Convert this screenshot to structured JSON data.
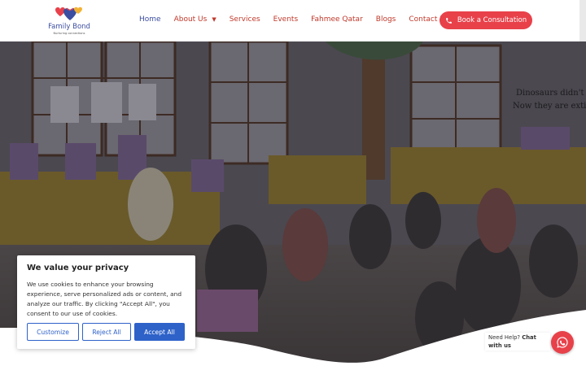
{
  "brand": {
    "name": "Family Bond",
    "tagline": "Nurturing connections"
  },
  "nav": {
    "items": [
      {
        "label": "Home"
      },
      {
        "label": "About Us"
      },
      {
        "label": "Services"
      },
      {
        "label": "Events"
      },
      {
        "label": "Fahmee Qatar"
      },
      {
        "label": "Blogs"
      },
      {
        "label": "Contact Us"
      }
    ],
    "cta": "Book a Consultation"
  },
  "hero": {
    "wall_text_1": "Dinosaurs didn't read",
    "wall_text_2": "Now they are extinc"
  },
  "cookie": {
    "title": "We value your privacy",
    "text": "We use cookies to enhance your browsing experience, serve personalized ads or content, and analyze our traffic. By clicking \"Accept All\", you consent to our use of cookies.",
    "customize": "Customize",
    "reject": "Reject All",
    "accept": "Accept All"
  },
  "chat": {
    "prefix": "Need Help?",
    "strong": "Chat with us"
  },
  "colors": {
    "accent_red": "#e8414a",
    "brand_blue": "#3b4da0",
    "button_blue": "#2e62c9"
  }
}
